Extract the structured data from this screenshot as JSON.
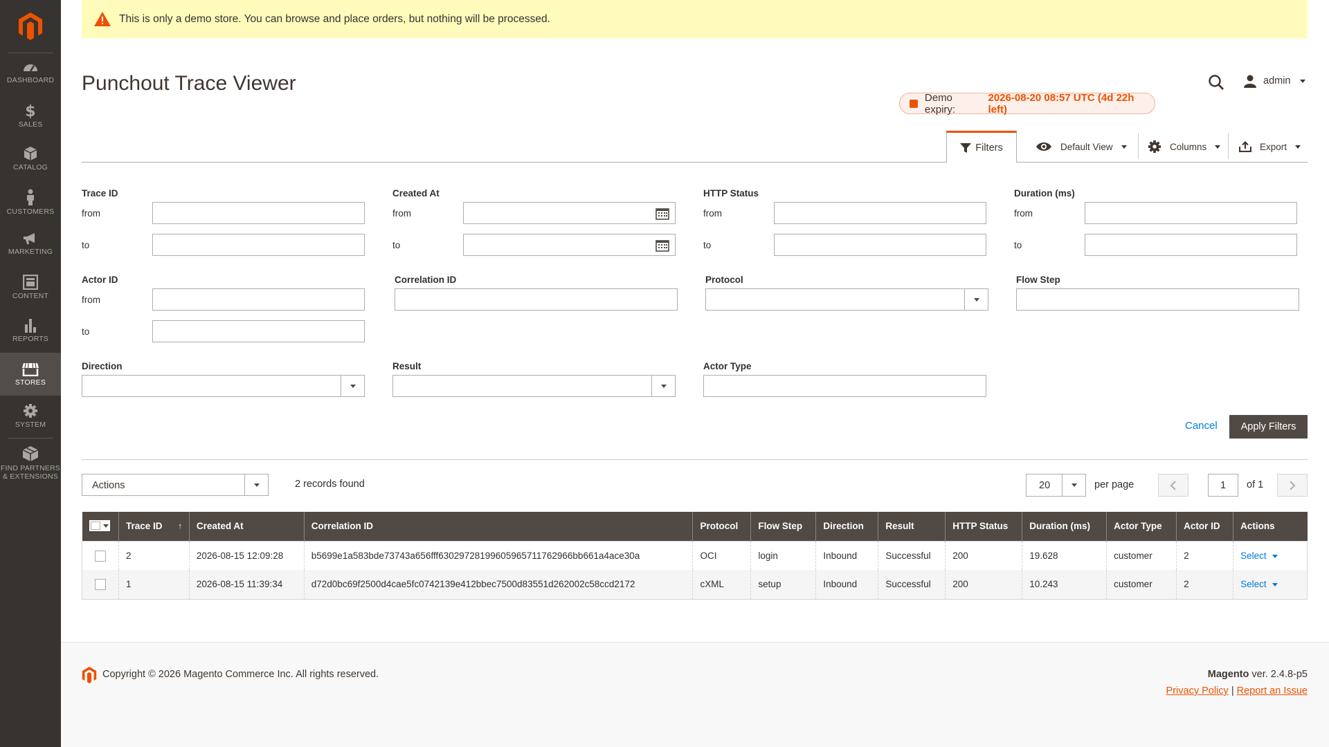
{
  "sidebar": {
    "items": [
      {
        "label": "DASHBOARD",
        "icon": "dashboard-icon"
      },
      {
        "label": "SALES",
        "icon": "dollar-icon"
      },
      {
        "label": "CATALOG",
        "icon": "box-icon"
      },
      {
        "label": "CUSTOMERS",
        "icon": "person-icon"
      },
      {
        "label": "MARKETING",
        "icon": "megaphone-icon"
      },
      {
        "label": "CONTENT",
        "icon": "layout-icon"
      },
      {
        "label": "REPORTS",
        "icon": "bar-chart-icon"
      },
      {
        "label": "STORES",
        "icon": "store-icon",
        "active": true
      },
      {
        "label": "SYSTEM",
        "icon": "gear-icon"
      },
      {
        "label": "FIND PARTNERS",
        "label2": "& EXTENSIONS",
        "icon": "extensions-icon"
      }
    ]
  },
  "notice": {
    "text": "This is only a demo store. You can browse and place orders, but nothing will be processed."
  },
  "header": {
    "title": "Punchout Trace Viewer",
    "user": "admin",
    "expiry_label": "Demo expiry:",
    "expiry_value": "2026-08-20 08:57 UTC (4d 22h left)"
  },
  "toolbar": {
    "filters": "Filters",
    "view": "Default View",
    "columns": "Columns",
    "export": "Export"
  },
  "filters": {
    "trace_id": "Trace ID",
    "created_at": "Created At",
    "http_status": "HTTP Status",
    "duration": "Duration (ms)",
    "actor_id": "Actor ID",
    "correlation_id": "Correlation ID",
    "protocol": "Protocol",
    "flow_step": "Flow Step",
    "direction": "Direction",
    "result": "Result",
    "actor_type": "Actor Type",
    "from": "from",
    "to": "to",
    "cancel": "Cancel",
    "apply": "Apply Filters"
  },
  "grid": {
    "actions": "Actions",
    "records": "2 records found",
    "per_page_value": "20",
    "per_page_label": "per page",
    "page": "1",
    "of": "of 1",
    "columns": [
      "Trace ID",
      "Created At",
      "Correlation ID",
      "Protocol",
      "Flow Step",
      "Direction",
      "Result",
      "HTTP Status",
      "Duration (ms)",
      "Actor Type",
      "Actor ID",
      "Actions"
    ],
    "rows": [
      {
        "trace_id": "2",
        "created_at": "2026-08-15 12:09:28",
        "correlation_id": "b5699e1a583bde73743a656fff63029728199605965711762966bb661a4ace30a",
        "protocol": "OCI",
        "flow_step": "login",
        "direction": "Inbound",
        "result": "Successful",
        "http_status": "200",
        "duration": "19.628",
        "actor_type": "customer",
        "actor_id": "2",
        "action": "Select"
      },
      {
        "trace_id": "1",
        "created_at": "2026-08-15 11:39:34",
        "correlation_id": "d72d0bc69f2500d4cae5fc0742139e412bbec7500d83551d262002c58ccd2172",
        "protocol": "cXML",
        "flow_step": "setup",
        "direction": "Inbound",
        "result": "Successful",
        "http_status": "200",
        "duration": "10.243",
        "actor_type": "customer",
        "actor_id": "2",
        "action": "Select"
      }
    ]
  },
  "footer": {
    "copyright": "Copyright © 2026 Magento Commerce Inc. All rights reserved.",
    "brand": "Magento",
    "version": " ver. 2.4.8-p5",
    "privacy": "Privacy Policy",
    "separator": "|",
    "report": "Report an Issue"
  },
  "colors": {
    "accent": "#eb5202",
    "sidebar": "#373330",
    "table_header": "#514943",
    "link": "#007bdb",
    "notice_bg": "#fffbbb"
  }
}
